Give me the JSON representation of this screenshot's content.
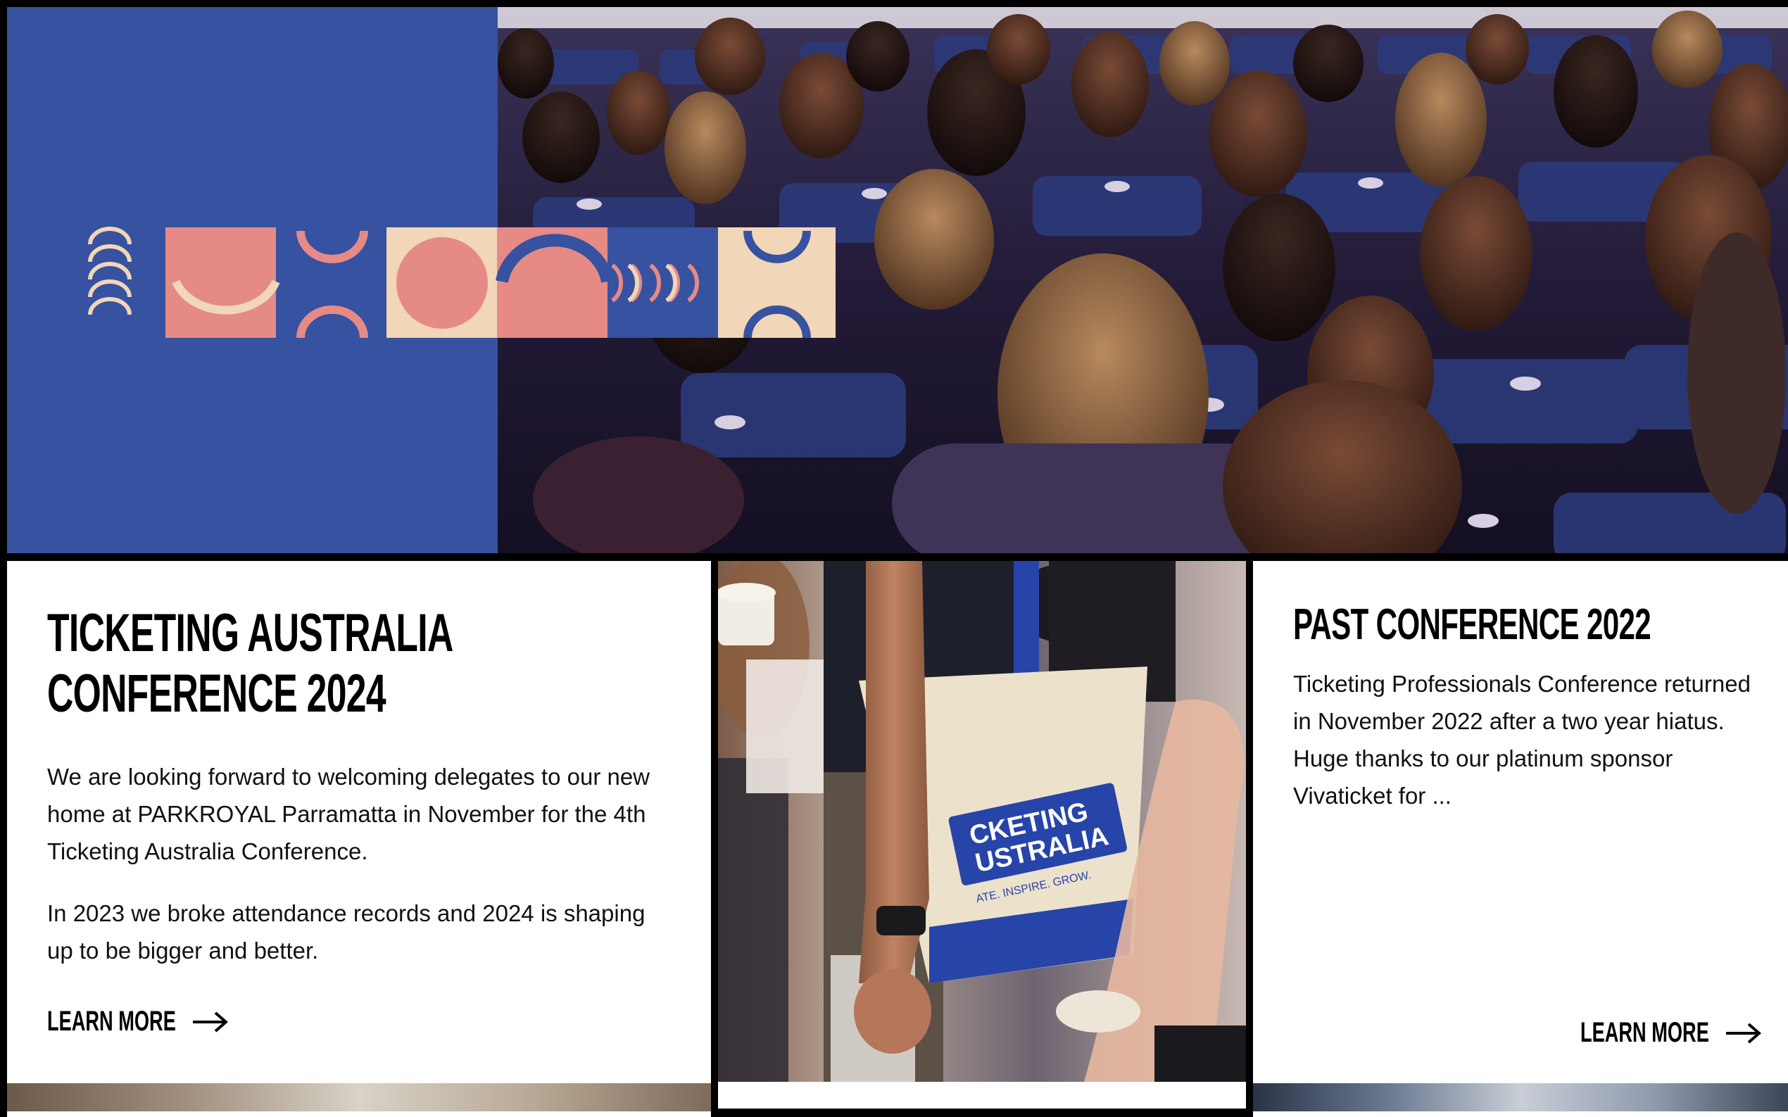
{
  "hero": {
    "image_alt": "Conference audience seated in blue theatre chairs",
    "colors": {
      "blue": "#3652a0",
      "pink": "#e68a86",
      "cream": "#f1d6b8"
    }
  },
  "cards": [
    {
      "title": "TICKETING AUSTRALIA CONFERENCE 2024",
      "paragraphs": [
        "We are looking forward to welcoming delegates to our new home at PARKROYAL Parramatta in November for the 4th Ticketing Australia Conference.",
        "In 2023 we broke attendance records and 2024 is shaping up to be bigger and better."
      ],
      "link_label": "LEARN MORE",
      "link_icon": "arrow-right-icon"
    },
    {
      "image_alt": "Person carrying a Ticketing Australia tote bag",
      "bag_text_line1": "CKETING",
      "bag_text_line2": "USTRALIA",
      "bag_tagline": "ATE. INSPIRE. GROW."
    },
    {
      "title": "PAST CONFERENCE 2022",
      "paragraphs": [
        "Ticketing Professionals Conference returned in November 2022 after a two year hiatus. Huge thanks to our platinum sponsor Vivaticket for ..."
      ],
      "link_label": "LEARN MORE",
      "link_icon": "arrow-right-icon"
    }
  ]
}
